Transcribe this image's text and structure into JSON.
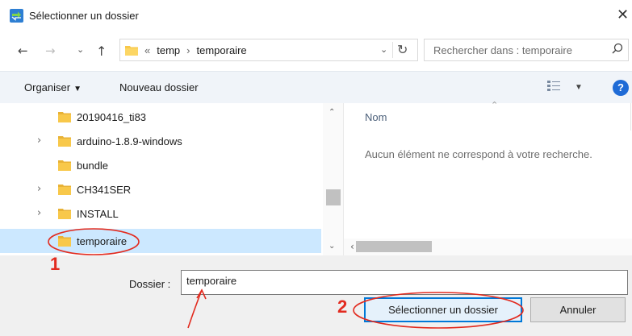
{
  "window": {
    "title": "Sélectionner un dossier",
    "close_icon": "close-icon"
  },
  "nav": {
    "back_icon": "arrow-left-icon",
    "forward_icon": "arrow-right-icon",
    "recent_icon": "chevron-down-icon",
    "up_icon": "arrow-up-icon",
    "breadcrumb": {
      "overflow": "«",
      "items": [
        "temp",
        "temporaire"
      ],
      "separator": "›"
    },
    "refresh_icon": "refresh-icon",
    "search_placeholder": "Rechercher dans : temporaire"
  },
  "toolbar": {
    "organize_label": "Organiser",
    "new_folder_label": "Nouveau dossier",
    "view_icon": "view-options-icon",
    "help_label": "?"
  },
  "tree": {
    "items": [
      {
        "label": "20190416_ti83",
        "expandable": false,
        "selected": false
      },
      {
        "label": "arduino-1.8.9-windows",
        "expandable": true,
        "selected": false
      },
      {
        "label": "bundle",
        "expandable": false,
        "selected": false
      },
      {
        "label": "CH341SER",
        "expandable": true,
        "selected": false
      },
      {
        "label": "INSTALL",
        "expandable": true,
        "selected": false
      },
      {
        "label": "temporaire",
        "expandable": false,
        "selected": true
      }
    ]
  },
  "content": {
    "column_name": "Nom",
    "empty_message": "Aucun élément ne correspond à votre recherche."
  },
  "footer": {
    "folder_label": "Dossier :",
    "folder_value": "temporaire",
    "select_button": "Sélectionner un dossier",
    "cancel_button": "Annuler"
  },
  "annotations": {
    "step1": "1",
    "step2": "2",
    "color": "#e22b1f"
  },
  "colors": {
    "accent": "#0078d7",
    "selection": "#cce8ff",
    "folder": "#f8c84a",
    "help": "#1f6bd6"
  }
}
